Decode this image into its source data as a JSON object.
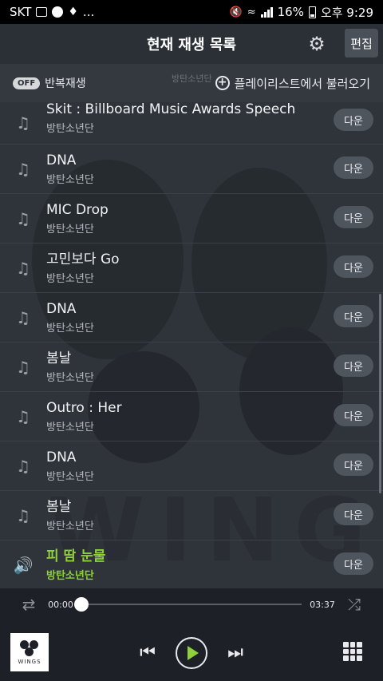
{
  "status_bar": {
    "carrier": "SKT",
    "dots": "...",
    "battery": "16%",
    "time": "오후 9:29"
  },
  "header": {
    "title": "현재 재생 목록",
    "settings_icon": "gear-icon",
    "edit_label": "편집"
  },
  "toolbar": {
    "repeat_toggle": "OFF",
    "repeat_label": "반복재생",
    "load_label": "플레이리스트에서 불러오기",
    "ghost_artist": "방탄소년단"
  },
  "download_label": "다운",
  "playlist": [
    {
      "title": "Skit : Billboard Music Awards Speech",
      "artist": "방탄소년단"
    },
    {
      "title": "DNA",
      "artist": "방탄소년단"
    },
    {
      "title": "MIC Drop",
      "artist": "방탄소년단"
    },
    {
      "title": "고민보다 Go",
      "artist": "방탄소년단"
    },
    {
      "title": "DNA",
      "artist": "방탄소년단"
    },
    {
      "title": "봄날",
      "artist": "방탄소년단"
    },
    {
      "title": "Outro : Her",
      "artist": "방탄소년단"
    },
    {
      "title": "DNA",
      "artist": "방탄소년단"
    },
    {
      "title": "봄날",
      "artist": "방탄소년단"
    },
    {
      "title": "피 땀 눈물",
      "artist": "방탄소년단",
      "playing": true
    }
  ],
  "player": {
    "current_time": "00:00",
    "total_time": "03:37",
    "progress": 0,
    "album_label": "WINGS"
  },
  "colors": {
    "accent": "#8fd13b",
    "background": "#1d2127"
  }
}
